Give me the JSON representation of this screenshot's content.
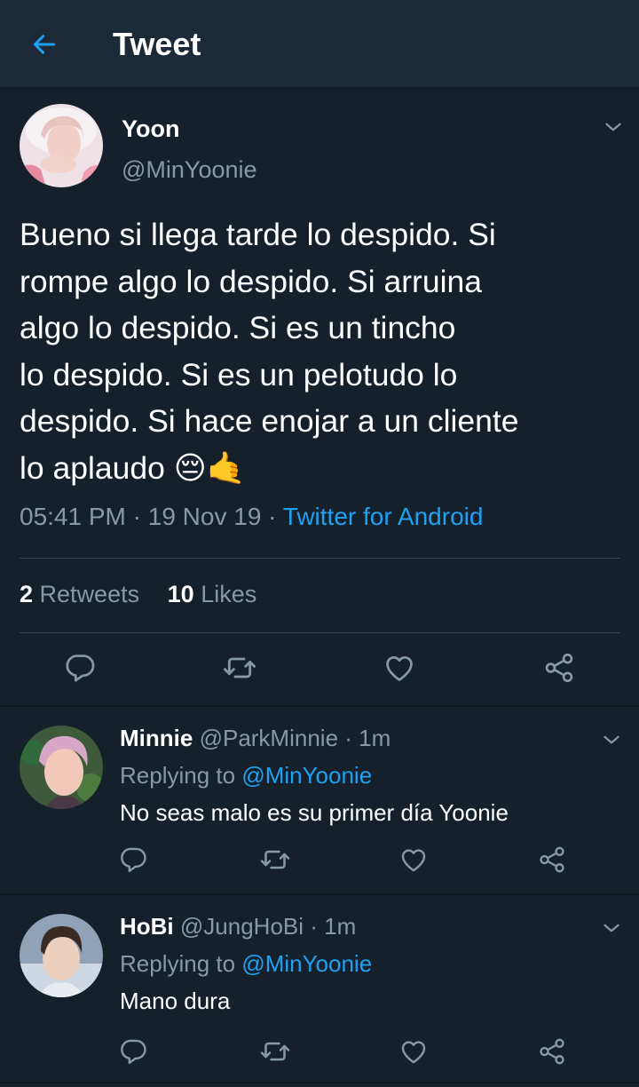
{
  "header": {
    "title": "Tweet",
    "back_icon": "arrow-left-icon",
    "accent_color": "#1da1f2"
  },
  "main_tweet": {
    "name": "Yoon",
    "handle": "@MinYoonie",
    "text": "Bueno si llega tarde lo despido. Si\nrompe algo lo despido. Si arruina\nalgo lo despido. Si es un tincho\nlo despido. Si es un pelotudo lo\ndespido. Si hace enojar a un cliente\nlo aplaudo 😔🤙",
    "time": "05:41 PM",
    "separator": "·",
    "date": "19 Nov 19",
    "source": "Twitter for Android",
    "retweets_count": "2",
    "retweets_label": "Retweets",
    "likes_count": "10",
    "likes_label": "Likes"
  },
  "replies": [
    {
      "name": "Minnie",
      "handle": "@ParkMinnie",
      "time": "1m",
      "separator": "·",
      "replying_label": "Replying to",
      "replying_to": "@MinYoonie",
      "text": "No seas malo es su primer día Yoonie"
    },
    {
      "name": "HoBi",
      "handle": "@JungHoBi",
      "time": "1m",
      "separator": "·",
      "replying_label": "Replying to",
      "replying_to": "@MinYoonie",
      "text": "Mano dura"
    }
  ],
  "icons": [
    "arrow-left-icon",
    "chevron-down-icon",
    "reply-icon",
    "retweet-icon",
    "like-icon",
    "share-icon"
  ],
  "colors": {
    "background": "#15202b",
    "header": "#1c2938",
    "secondary_text": "#8899a6",
    "link": "#1da1f2"
  }
}
